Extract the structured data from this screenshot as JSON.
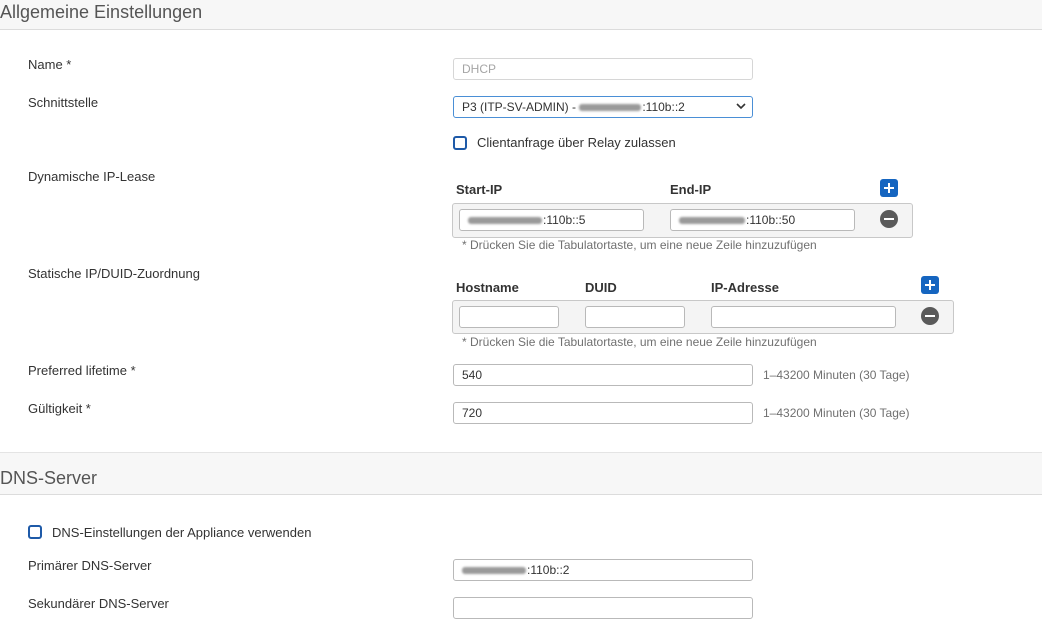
{
  "general": {
    "title": "Allgemeine Einstellungen",
    "name_label": "Name *",
    "name_placeholder": "DHCP",
    "interface_label": "Schnittstelle",
    "interface_value_prefix": "P3 (ITP-SV-ADMIN) - ",
    "interface_value_suffix": ":110b::2",
    "relay_label": "Clientanfrage über Relay zulassen",
    "dynamic_label": "Dynamische IP-Lease",
    "dynamic_cols": [
      "Start-IP",
      "End-IP"
    ],
    "start_ip_suffix": ":110b::5",
    "end_ip_suffix": ":110b::50",
    "tab_hint": "* Drücken Sie die Tabulatortaste, um eine neue Zeile hinzuzufügen",
    "static_label": "Statische IP/DUID-Zuordnung",
    "static_cols": [
      "Hostname",
      "DUID",
      "IP-Adresse"
    ],
    "preferred_label": "Preferred lifetime *",
    "preferred_value": "540",
    "preferred_unit": "1–43200 Minuten (30 Tage)",
    "validity_label": "Gültigkeit *",
    "validity_value": "720",
    "validity_unit": "1–43200 Minuten (30 Tage)"
  },
  "dns": {
    "title": "DNS-Server",
    "appliance_label": "DNS-Einstellungen der Appliance verwenden",
    "primary_label": "Primärer DNS-Server",
    "primary_suffix": ":110b::2",
    "secondary_label": "Sekundärer DNS-Server",
    "secondary_value": ""
  },
  "colors": {
    "accent": "#1565c0",
    "checkbox_border": "#1e5aa8",
    "select_border": "#4a8fd6"
  }
}
